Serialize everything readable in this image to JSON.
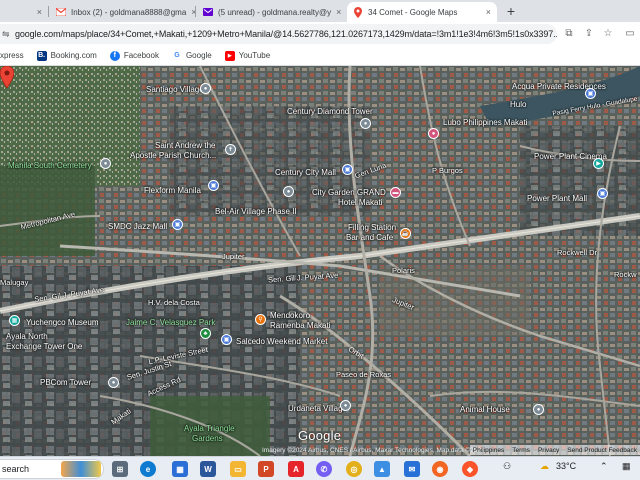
{
  "tabs": [
    {
      "title": "Inbox (2) - goldmana8888@gma",
      "close": "×",
      "icon": "gmail-icon"
    },
    {
      "title": "(5 unread) - goldmana.realty@y",
      "close": "×",
      "icon": "yahoo-mail-icon"
    },
    {
      "title": "34 Comet - Google Maps",
      "close": "×",
      "icon": "google-maps-icon",
      "active": true
    }
  ],
  "leading_tab_close": "×",
  "new_tab": "+",
  "url": "google.com/maps/place/34+Comet,+Makati,+1209+Metro+Manila/@14.5627786,121.0267173,1429m/data=!3m1!1e3!4m6!3m5!1s0x3397...",
  "bookmarks": [
    {
      "label": "xpress",
      "icon": "bookmark-icon",
      "color": "#e0e0e0"
    },
    {
      "label": "Booking.com",
      "icon": "booking-icon",
      "color": "#003580",
      "glyph": "B."
    },
    {
      "label": "Facebook",
      "icon": "facebook-icon",
      "color": "#1877f2",
      "glyph": "f"
    },
    {
      "label": "Google",
      "icon": "google-icon",
      "color": "#ffffff",
      "glyph": "G"
    },
    {
      "label": "YouTube",
      "icon": "youtube-icon",
      "color": "#ff0000",
      "glyph": "▶"
    }
  ],
  "map": {
    "labels": [
      {
        "text": "Santiago Village",
        "style": ""
      },
      {
        "text": "Century Diamond Tower",
        "style": ""
      },
      {
        "text": "Acqua Private Residences",
        "style": ""
      },
      {
        "text": "Hulo",
        "style": ""
      },
      {
        "text": "Lubo Philippines Makati",
        "style": ""
      },
      {
        "text": "Pasig Ferry Hulo - Guadalupe",
        "style": ""
      },
      {
        "text": "Saint Andrew the",
        "style": ""
      },
      {
        "text": "Apostle Parish Church...",
        "style": ""
      },
      {
        "text": "Manila South Cemetery",
        "style": "green"
      },
      {
        "text": "Century City Mall",
        "style": ""
      },
      {
        "text": "Gen Luna",
        "style": "road"
      },
      {
        "text": "P Burgos",
        "style": "road"
      },
      {
        "text": "Power Plant Cinema",
        "style": ""
      },
      {
        "text": "City Garden GRAND",
        "style": ""
      },
      {
        "text": "Hotel Makati",
        "style": ""
      },
      {
        "text": "Flexform Manila",
        "style": ""
      },
      {
        "text": "Power Plant Mall",
        "style": ""
      },
      {
        "text": "Bel-Air Village Phase II",
        "style": ""
      },
      {
        "text": "SMDC Jazz Mall",
        "style": ""
      },
      {
        "text": "Filling Station",
        "style": ""
      },
      {
        "text": "Bar and Cafe",
        "style": ""
      },
      {
        "text": "Metropolitan Ave",
        "style": "road"
      },
      {
        "text": "Jupiter",
        "style": "road"
      },
      {
        "text": "Rockwell Dr",
        "style": "road"
      },
      {
        "text": "Rockw",
        "style": "road"
      },
      {
        "text": "Malugay",
        "style": "road"
      },
      {
        "text": "Sen. Gil J. Puyat Ave",
        "style": "road"
      },
      {
        "text": "Sen. Gil J. Puyat Ave",
        "style": "road"
      },
      {
        "text": "Polaris",
        "style": "road"
      },
      {
        "text": "H.V. dela Costa",
        "style": "road"
      },
      {
        "text": "Yuchengco Museum",
        "style": ""
      },
      {
        "text": "Jaime C. Velasquez Park",
        "style": "green"
      },
      {
        "text": "Mendokoro",
        "style": ""
      },
      {
        "text": "Ramenba Makati",
        "style": ""
      },
      {
        "text": "Jupiter",
        "style": "road"
      },
      {
        "text": "Ayala North",
        "style": ""
      },
      {
        "text": "Exchange Tower One",
        "style": ""
      },
      {
        "text": "Salcedo Weekend Market",
        "style": ""
      },
      {
        "text": "L.P. Leviste Street",
        "style": "road"
      },
      {
        "text": "Orbit",
        "style": "road"
      },
      {
        "text": "Paseo de Roxas",
        "style": "road"
      },
      {
        "text": "PBCom Tower",
        "style": ""
      },
      {
        "text": "Sen. Justin St",
        "style": "road"
      },
      {
        "text": "Access Rd",
        "style": "road"
      },
      {
        "text": "Urdaneta Village",
        "style": ""
      },
      {
        "text": "Animal House",
        "style": ""
      },
      {
        "text": "Ayala Triangle",
        "style": "green"
      },
      {
        "text": "Gardens",
        "style": "green"
      },
      {
        "text": "Makati",
        "style": "road"
      }
    ],
    "logo": "Google",
    "imagery": "Imagery ©2024 Airbus, CNES / Airbus, Maxar Technologies, Map data ©2024",
    "footer_links": [
      "Philippines",
      "Terms",
      "Privacy",
      "Send Product Feedback"
    ]
  },
  "taskbar": {
    "search_label": "search",
    "apps": [
      {
        "name": "task-view-icon",
        "color": "#5b6b7c",
        "glyph": "⊞"
      },
      {
        "name": "edge-icon",
        "color": "#0f7bd0",
        "glyph": "e"
      },
      {
        "name": "store-icon",
        "color": "#2b6fd6",
        "glyph": "▦"
      },
      {
        "name": "word-icon",
        "color": "#2b579a",
        "glyph": "W"
      },
      {
        "name": "folder-icon",
        "color": "#f2b632",
        "glyph": "▭"
      },
      {
        "name": "powerpoint-icon",
        "color": "#d24726",
        "glyph": "P"
      },
      {
        "name": "acrobat-icon",
        "color": "#e5252a",
        "glyph": "A"
      },
      {
        "name": "viber-icon",
        "color": "#7360f2",
        "glyph": "✆"
      },
      {
        "name": "chrome-icon",
        "color": "#e3b01a",
        "glyph": "◎"
      },
      {
        "name": "gallery-icon",
        "color": "#3c8fe3",
        "glyph": "▲"
      },
      {
        "name": "mail-icon",
        "color": "#2670d6",
        "glyph": "✉"
      },
      {
        "name": "rss-icon",
        "color": "#f26522",
        "glyph": "◉"
      },
      {
        "name": "brave-icon",
        "color": "#fb542b",
        "glyph": "◆"
      }
    ],
    "temperature": "33°C"
  }
}
